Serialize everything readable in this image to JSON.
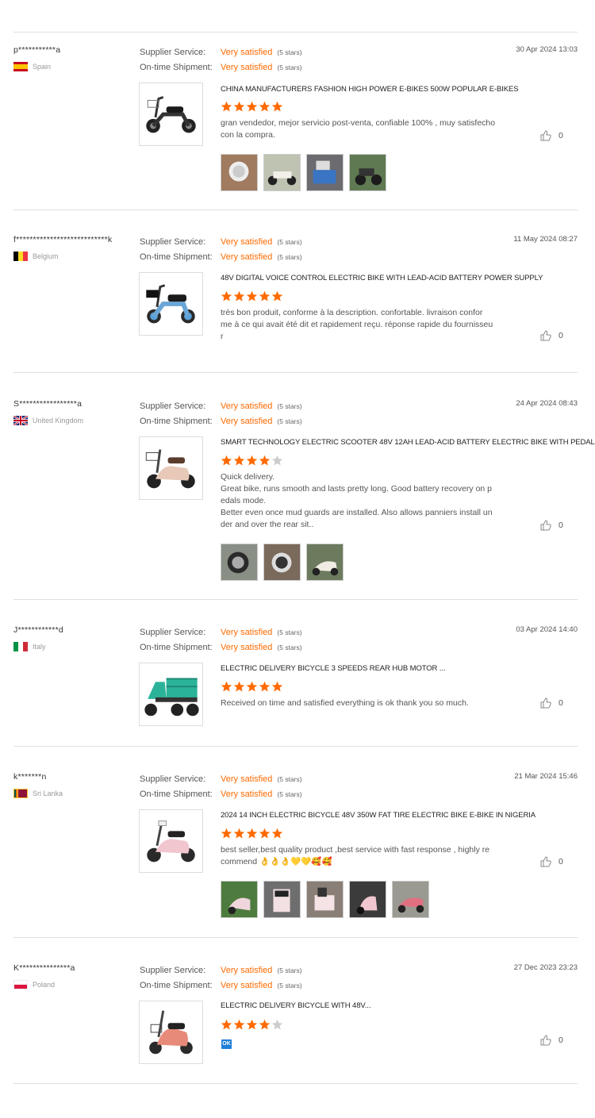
{
  "labels": {
    "supplier_service": "Supplier Service:",
    "shipment": "On-time Shipment:"
  },
  "reviews": [
    {
      "user": "p***********a",
      "country": "Spain",
      "date": "30 Apr 2024 13:03",
      "supplier_rating": "Very satisfied",
      "supplier_stars": "(5 stars)",
      "shipment_rating": "Very satisfied",
      "shipment_stars": "(5 stars)",
      "product_title": "CHINA MANUFACTURERS FASHION HIGH POWER E-BIKES 500W POPULAR E-BIKES",
      "rating": 5,
      "comment": "gran vendedor, mejor servicio post-venta, confiable 100% , muy satisfecho\ncon la compra.",
      "likes": "0",
      "photo_count": 4
    },
    {
      "user": "f***************************k",
      "country": "Belgium",
      "date": "11 May 2024 08:27",
      "supplier_rating": "Very satisfied",
      "supplier_stars": "(5 stars)",
      "shipment_rating": "Very satisfied",
      "shipment_stars": "(5 stars)",
      "product_title": "48V DIGITAL VOICE CONTROL ELECTRIC BIKE WITH LEAD-ACID BATTERY POWER SUPPLY",
      "rating": 5,
      "comment": "très bon produit, conforme à la description. confortable. livraison confor\nme à ce qui avait été dit et rapidement reçu. réponse rapide du fournisseu\nr",
      "likes": "0",
      "photo_count": 0
    },
    {
      "user": "S*****************a",
      "country": "United Kingdom",
      "date": "24 Apr 2024 08:43",
      "supplier_rating": "Very satisfied",
      "supplier_stars": "(5 stars)",
      "shipment_rating": "Very satisfied",
      "shipment_stars": "(5 stars)",
      "product_title": "SMART TECHNOLOGY ELECTRIC SCOOTER 48V 12AH LEAD-ACID BATTERY ELECTRIC BIKE WITH PEDAL",
      "rating": 4,
      "comment": "Quick delivery.\nGreat bike, runs smooth and lasts pretty long. Good battery recovery on p\nedals mode.\nBetter even once mud guards are installed. Also allows panniers install un\nder and over the rear sit..",
      "likes": "0",
      "photo_count": 3
    },
    {
      "user": "J************d",
      "country": "Italy",
      "date": "03 Apr 2024 14:40",
      "supplier_rating": "Very satisfied",
      "supplier_stars": "(5 stars)",
      "shipment_rating": "Very satisfied",
      "shipment_stars": "(5 stars)",
      "product_title": "ELECTRIC DELIVERY BICYCLE 3 SPEEDS REAR HUB MOTOR ...",
      "rating": 5,
      "comment": "Received on time and satisfied everything is ok thank you so much.",
      "likes": "0",
      "photo_count": 0
    },
    {
      "user": "k*******n",
      "country": "Sri Lanka",
      "date": "21 Mar 2024 15:46",
      "supplier_rating": "Very satisfied",
      "supplier_stars": "(5 stars)",
      "shipment_rating": "Very satisfied",
      "shipment_stars": "(5 stars)",
      "product_title": "2024 14 INCH ELECTRIC BICYCLE 48V 350W FAT TIRE ELECTRIC BIKE E-BIKE IN NIGERIA",
      "rating": 5,
      "comment": "best seller,best quality product ,best service with fast response , highly re\ncommend 👌👌👌💛💛🥰🥰",
      "likes": "0",
      "photo_count": 5
    },
    {
      "user": "K***************a",
      "country": "Poland",
      "date": "27 Dec 2023 23:23",
      "supplier_rating": "Very satisfied",
      "supplier_stars": "(5 stars)",
      "shipment_rating": "Very satisfied",
      "shipment_stars": "(5 stars)",
      "product_title": "ELECTRIC DELIVERY BICYCLE WITH 48V...",
      "rating": 4,
      "comment": "OK",
      "likes": "0",
      "photo_count": 0
    }
  ],
  "colors": {
    "accent": "#ff6a00",
    "star_on": "#ff6a00",
    "star_off": "#cccccc"
  }
}
